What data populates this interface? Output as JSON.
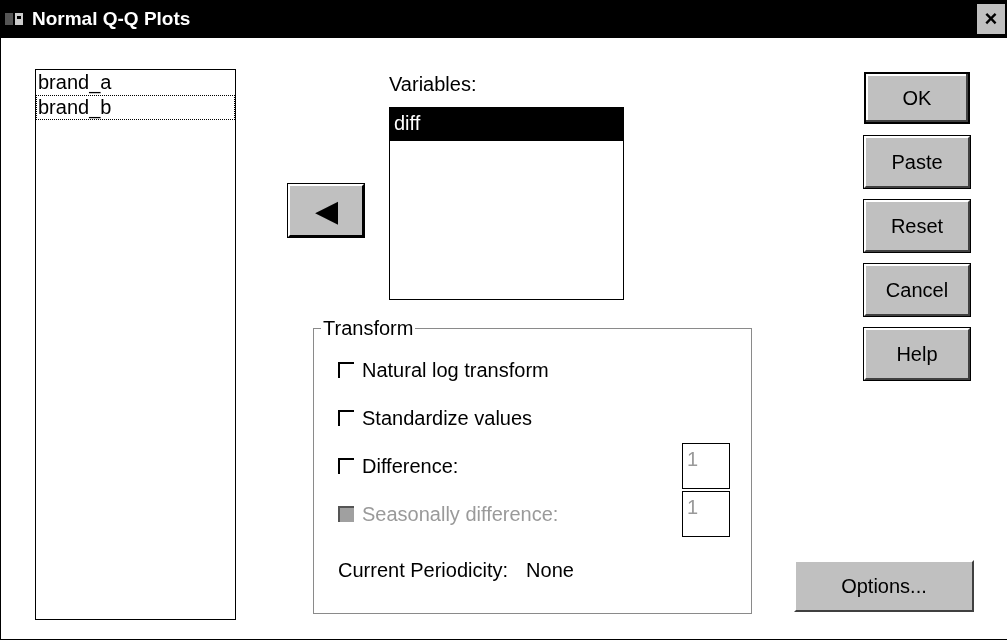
{
  "window": {
    "title": "Normal Q-Q Plots",
    "close": "×"
  },
  "source_list": {
    "items": [
      {
        "label": "brand_a",
        "focused": false
      },
      {
        "label": "brand_b",
        "focused": true
      }
    ]
  },
  "move_button": {
    "glyph": "◀"
  },
  "variables": {
    "label": "Variables:",
    "items": [
      {
        "label": "diff",
        "selected": true
      }
    ]
  },
  "transform": {
    "title": "Transform",
    "options": [
      {
        "kind": "checkbox",
        "label": "Natural log transform",
        "checked": false,
        "disabled": false
      },
      {
        "kind": "checkbox",
        "label": "Standardize values",
        "checked": false,
        "disabled": false
      },
      {
        "kind": "checkbox-field",
        "label": "Difference:",
        "checked": false,
        "disabled": false,
        "value": "1"
      },
      {
        "kind": "checkbox-field",
        "label": "Seasonally difference:",
        "checked": false,
        "disabled": true,
        "value": "1"
      }
    ],
    "periodicity_label": "Current Periodicity:",
    "periodicity_value": "None"
  },
  "buttons": [
    {
      "label": "OK",
      "default": true
    },
    {
      "label": "Paste",
      "default": false
    },
    {
      "label": "Reset",
      "default": false
    },
    {
      "label": "Cancel",
      "default": false
    },
    {
      "label": "Help",
      "default": false
    }
  ],
  "options_button": {
    "label": "Options..."
  }
}
